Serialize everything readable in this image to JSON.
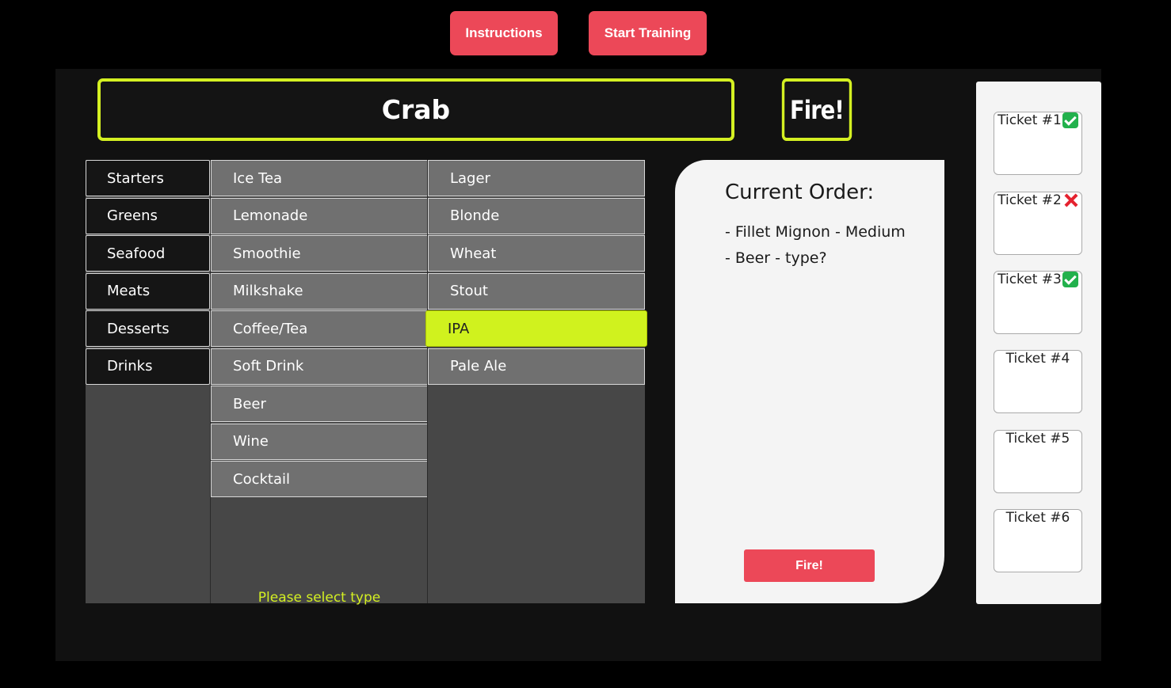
{
  "header": {
    "instructions_label": "Instructions",
    "start_training_label": "Start Training"
  },
  "current_item": "Crab",
  "fire_label_top": "Fire!",
  "categories": [
    "Starters",
    "Greens",
    "Seafood",
    "Meats",
    "Desserts",
    "Drinks"
  ],
  "drink_types": [
    "Ice Tea",
    "Lemonade",
    "Smoothie",
    "Milkshake",
    "Coffee/Tea",
    "Soft Drink",
    "Beer",
    "Wine",
    "Cocktail"
  ],
  "beer_types": [
    "Lager",
    "Blonde",
    "Wheat",
    "Stout",
    "IPA",
    "Pale Ale"
  ],
  "selected_beer": "IPA",
  "prompt": "Please select type",
  "order": {
    "title": "Current Order:",
    "items": [
      "- Fillet Mignon - Medium",
      "- Beer - type?"
    ],
    "fire_label": "Fire!"
  },
  "tickets": [
    {
      "label": "Ticket #1",
      "status": "check",
      "status_icon": "check-mark-icon"
    },
    {
      "label": "Ticket #2",
      "status": "cross",
      "status_icon": "cross-mark-icon"
    },
    {
      "label": "Ticket #3",
      "status": "check",
      "status_icon": "check-mark-icon"
    },
    {
      "label": "Ticket #4",
      "status": "none"
    },
    {
      "label": "Ticket #5",
      "status": "none"
    },
    {
      "label": "Ticket #6",
      "status": "none"
    }
  ],
  "colors": {
    "accent": "#d4f022",
    "button": "#ec4858",
    "background": "#000000",
    "stage": "#111111"
  }
}
